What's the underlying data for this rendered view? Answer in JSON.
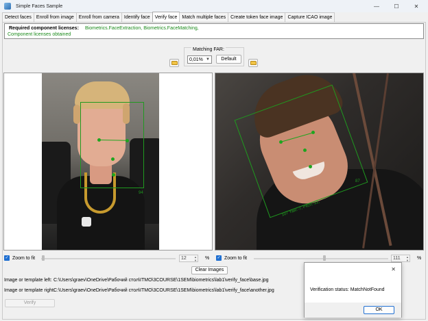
{
  "window": {
    "title": "Simple Faces Sample",
    "controls": {
      "minimize": "—",
      "maximize": "☐",
      "close": "✕"
    }
  },
  "tabs": [
    {
      "label": "Detect faces",
      "active": false
    },
    {
      "label": "Enroll from image",
      "active": false
    },
    {
      "label": "Enroll from camera",
      "active": false
    },
    {
      "label": "Identify face",
      "active": false
    },
    {
      "label": "Verify face",
      "active": true
    },
    {
      "label": "Match multiple faces",
      "active": false
    },
    {
      "label": "Create token face image",
      "active": false
    },
    {
      "label": "Capture ICAO image",
      "active": false
    }
  ],
  "licenses": {
    "title": "Required component licenses:",
    "names": "Biometrics.FaceExtraction, Biometrics.FaceMatching,",
    "status": "Component licenses obtained",
    "status_color": "#1a8a1a"
  },
  "matching": {
    "label": "Matching FAR:",
    "value": "0,01%",
    "default_label": "Default"
  },
  "left_viewer": {
    "detection_label": "94",
    "zoom_label": "Zoom to fit",
    "zoom_checked": true,
    "zoom_value": "12",
    "unit": "%"
  },
  "right_viewer": {
    "detection_label_score": "107",
    "detection_label_pose": "Yaw:-7, Pitch:-22,",
    "detection_label_corner": "87",
    "zoom_label": "Zoom to fit",
    "zoom_checked": true,
    "zoom_value": "111",
    "unit": "%"
  },
  "clear_images_label": "Clear Images",
  "paths": {
    "left_label": "Image or template left:",
    "left_value": "C:\\Users\\graev\\OneDrive\\Рабочий стол\\ITMO\\3COURSE\\1SEM\\biometrics\\lab1\\verify_face\\base.jpg",
    "right_label": "Image or template right:",
    "right_value": "C:\\Users\\graev\\OneDrive\\Рабочий стол\\ITMO\\3COURSE\\1SEM\\biometrics\\lab1\\verify_face\\another.jpg"
  },
  "verify_label": "Verify",
  "dialog": {
    "message": "Verification status: MatchNotFound",
    "ok_label": "OK",
    "close_glyph": "✕"
  },
  "colors": {
    "accent": "#1f6fd1",
    "detection": "#1f9a1f"
  }
}
